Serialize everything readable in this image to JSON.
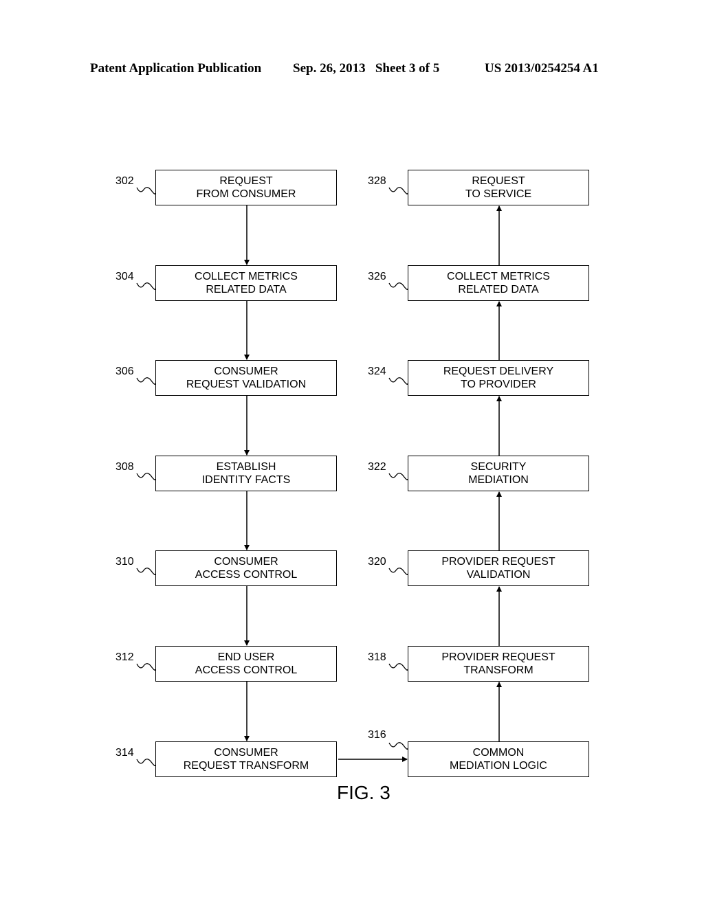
{
  "header": {
    "publication": "Patent Application Publication",
    "date_sheet": "Sep. 26, 2013   Sheet 3 of 5",
    "number": "US 2013/0254254 A1"
  },
  "figure_label": "FIG. 3",
  "left_column": [
    {
      "ref": "302",
      "line1": "REQUEST",
      "line2": "FROM CONSUMER"
    },
    {
      "ref": "304",
      "line1": "COLLECT METRICS",
      "line2": "RELATED DATA"
    },
    {
      "ref": "306",
      "line1": "CONSUMER",
      "line2": "REQUEST VALIDATION"
    },
    {
      "ref": "308",
      "line1": "ESTABLISH",
      "line2": "IDENTITY FACTS"
    },
    {
      "ref": "310",
      "line1": "CONSUMER",
      "line2": "ACCESS CONTROL"
    },
    {
      "ref": "312",
      "line1": "END USER",
      "line2": "ACCESS CONTROL"
    },
    {
      "ref": "314",
      "line1": "CONSUMER",
      "line2": "REQUEST TRANSFORM"
    }
  ],
  "right_column": [
    {
      "ref": "328",
      "line1": "REQUEST",
      "line2": "TO SERVICE"
    },
    {
      "ref": "326",
      "line1": "COLLECT METRICS",
      "line2": "RELATED DATA"
    },
    {
      "ref": "324",
      "line1": "REQUEST DELIVERY",
      "line2": "TO PROVIDER"
    },
    {
      "ref": "322",
      "line1": "SECURITY",
      "line2": "MEDIATION"
    },
    {
      "ref": "320",
      "line1": "PROVIDER REQUEST",
      "line2": "VALIDATION"
    },
    {
      "ref": "318",
      "line1": "PROVIDER REQUEST",
      "line2": "TRANSFORM"
    },
    {
      "ref": "316",
      "line1": "COMMON",
      "line2": "MEDIATION LOGIC"
    }
  ]
}
